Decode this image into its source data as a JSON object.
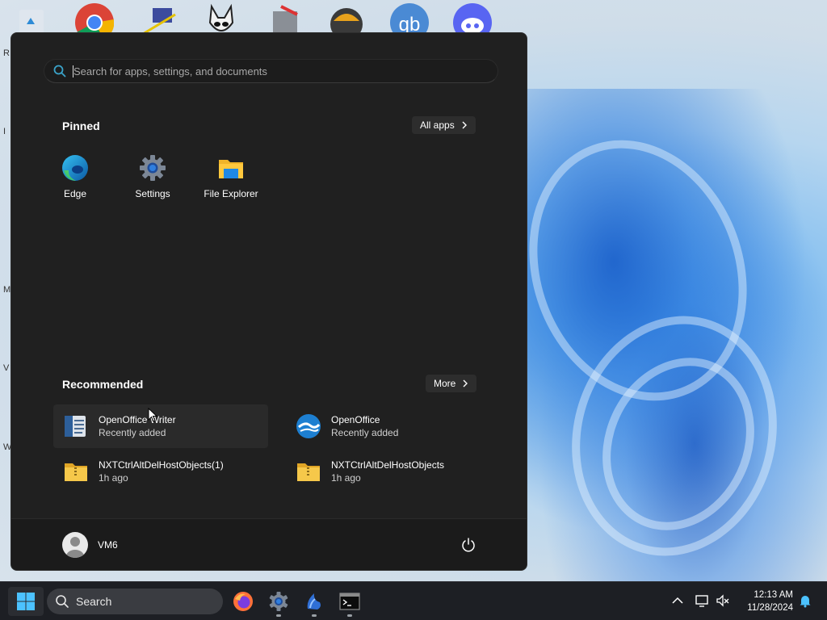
{
  "desktop": {
    "side_labels": [
      "R",
      "I",
      "M",
      "V",
      "W"
    ]
  },
  "start_menu": {
    "search": {
      "placeholder": "Search for apps, settings, and documents",
      "value": ""
    },
    "pinned": {
      "title": "Pinned",
      "all_apps_label": "All apps",
      "apps": [
        {
          "label": "Edge",
          "icon": "edge-icon"
        },
        {
          "label": "Settings",
          "icon": "settings-gear-icon"
        },
        {
          "label": "File Explorer",
          "icon": "folder-icon"
        }
      ]
    },
    "recommended": {
      "title": "Recommended",
      "more_label": "More",
      "items": [
        {
          "name": "OpenOffice Writer",
          "sub": "Recently added",
          "icon": "writer-icon"
        },
        {
          "name": "OpenOffice",
          "sub": "Recently added",
          "icon": "openoffice-icon"
        },
        {
          "name": "NXTCtrlAltDelHostObjects(1)",
          "sub": "1h ago",
          "icon": "zip-folder-icon"
        },
        {
          "name": "NXTCtrlAltDelHostObjects",
          "sub": "1h ago",
          "icon": "zip-folder-icon"
        }
      ]
    },
    "user": {
      "name": "VM6"
    }
  },
  "taskbar": {
    "search_label": "Search",
    "apps": [
      "firefox-icon",
      "settings-icon",
      "openoffice-icon",
      "terminal-icon"
    ],
    "clock": {
      "time": "12:13 AM",
      "date": "11/28/2024"
    }
  },
  "colors": {
    "menu_bg": "#202020",
    "taskbar_bg": "#1d1f24",
    "accent": "#0078d4"
  }
}
